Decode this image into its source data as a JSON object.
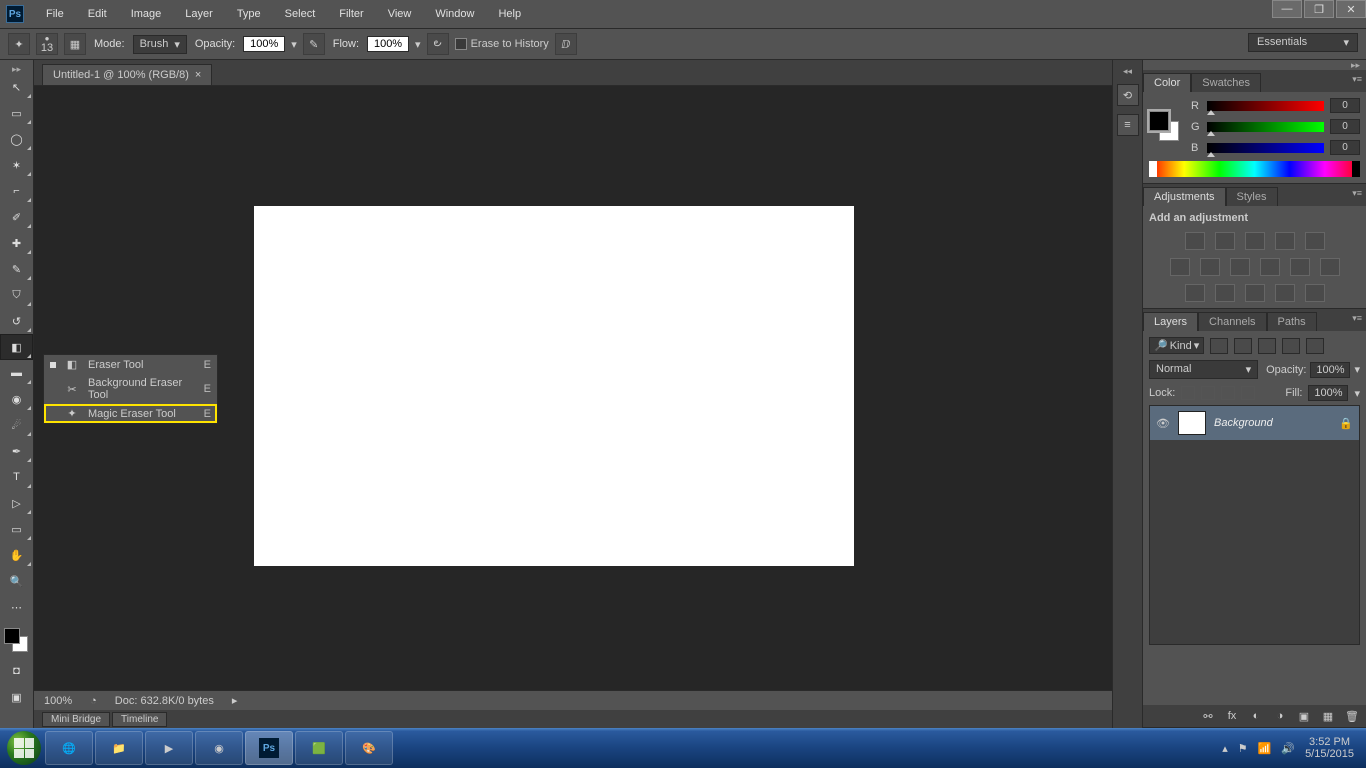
{
  "app": {
    "name": "Ps"
  },
  "menu": [
    "File",
    "Edit",
    "Image",
    "Layer",
    "Type",
    "Select",
    "Filter",
    "View",
    "Window",
    "Help"
  ],
  "options": {
    "brush_size": "13",
    "mode_label": "Mode:",
    "mode_value": "Brush",
    "opacity_label": "Opacity:",
    "opacity_value": "100%",
    "flow_label": "Flow:",
    "flow_value": "100%",
    "erase_history": "Erase to History",
    "workspace": "Essentials"
  },
  "doc": {
    "tab": "Untitled-1 @ 100% (RGB/8)",
    "zoom": "100%",
    "docinfo": "Doc: 632.8K/0 bytes",
    "bottom_tabs": [
      "Mini Bridge",
      "Timeline"
    ]
  },
  "flyout": [
    {
      "label": "Eraser Tool",
      "shortcut": "E",
      "selected": true
    },
    {
      "label": "Background Eraser Tool",
      "shortcut": "E",
      "selected": false
    },
    {
      "label": "Magic Eraser Tool",
      "shortcut": "E",
      "selected": false,
      "highlight": true
    }
  ],
  "panels": {
    "color": {
      "tabs": [
        "Color",
        "Swatches"
      ],
      "r": "0",
      "g": "0",
      "b": "0",
      "labels": {
        "r": "R",
        "g": "G",
        "b": "B"
      }
    },
    "adjustments": {
      "tabs": [
        "Adjustments",
        "Styles"
      ],
      "heading": "Add an adjustment"
    },
    "layers": {
      "tabs": [
        "Layers",
        "Channels",
        "Paths"
      ],
      "kind": "Kind",
      "blend": "Normal",
      "opacity_label": "Opacity:",
      "opacity": "100%",
      "lock_label": "Lock:",
      "fill_label": "Fill:",
      "fill": "100%",
      "items": [
        {
          "name": "Background",
          "locked": true
        }
      ]
    }
  },
  "taskbar": {
    "time": "3:52 PM",
    "date": "5/15/2015"
  }
}
